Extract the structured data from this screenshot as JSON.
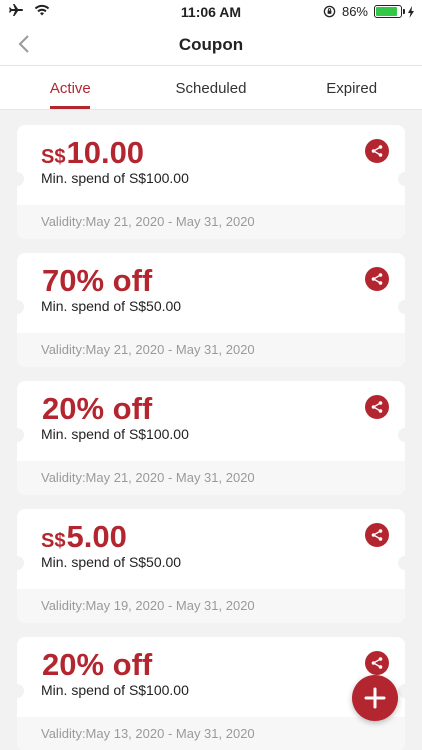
{
  "status_bar": {
    "time": "11:06 AM",
    "battery_percent": "86%",
    "battery_level": 0.86,
    "icons": [
      "airplane-icon",
      "wifi-icon",
      "orientation-lock-icon",
      "battery-icon",
      "charging-icon"
    ]
  },
  "nav": {
    "title": "Coupon",
    "back_icon": "chevron-left-icon"
  },
  "tabs": [
    {
      "label": "Active",
      "active": true
    },
    {
      "label": "Scheduled",
      "active": false
    },
    {
      "label": "Expired",
      "active": false
    }
  ],
  "coupons": [
    {
      "currency": "S$",
      "value": "10.00",
      "min_spend": "Min. spend of S$100.00",
      "validity": "Validity:May 21, 2020 - May 31, 2020"
    },
    {
      "currency": "",
      "value": "70% off",
      "min_spend": "Min. spend of S$50.00",
      "validity": "Validity:May 21, 2020 - May 31, 2020"
    },
    {
      "currency": "",
      "value": "20% off",
      "min_spend": "Min. spend of S$100.00",
      "validity": "Validity:May 21, 2020 - May 31, 2020"
    },
    {
      "currency": "S$",
      "value": "5.00",
      "min_spend": "Min. spend of S$50.00",
      "validity": "Validity:May 19, 2020 - May 31, 2020"
    },
    {
      "currency": "",
      "value": "20% off",
      "min_spend": "Min. spend of S$100.00",
      "validity": "Validity:May 13, 2020 - May 31, 2020"
    }
  ],
  "colors": {
    "accent": "#b3262f",
    "background": "#f2f2f2",
    "battery": "#33c748"
  },
  "fab_icon": "plus-icon",
  "share_icon": "share-icon"
}
